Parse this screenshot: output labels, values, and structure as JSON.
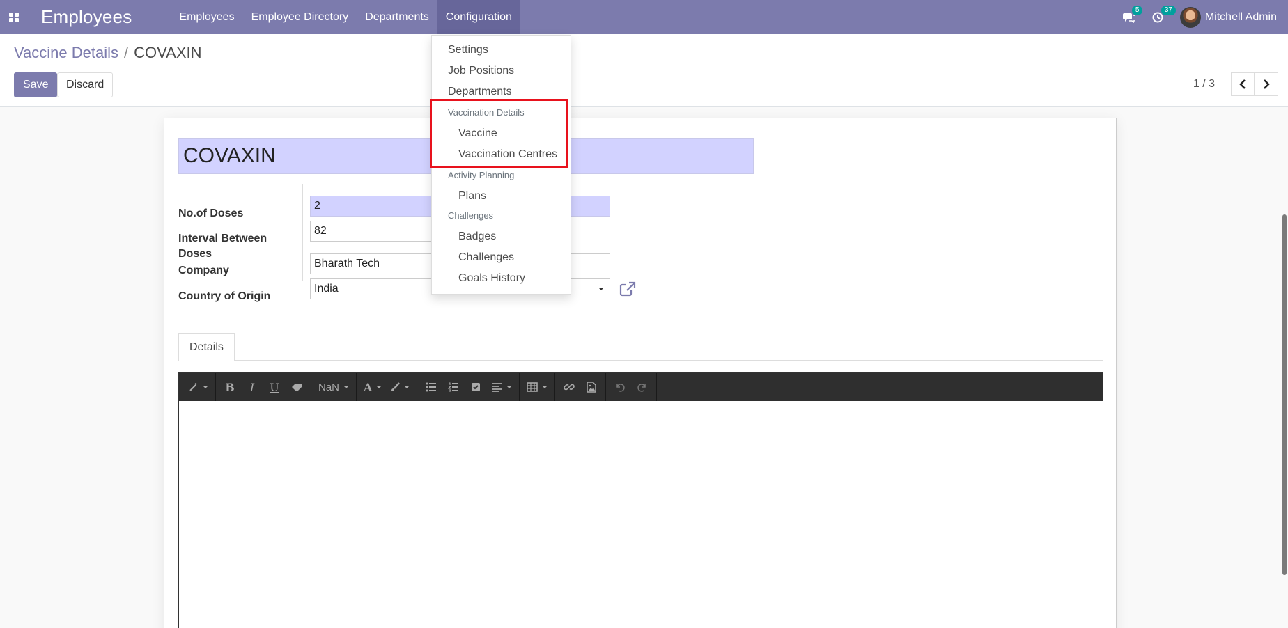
{
  "navbar": {
    "app_title": "Employees",
    "menu": [
      "Employees",
      "Employee Directory",
      "Departments",
      "Configuration"
    ],
    "messages_count": "5",
    "activities_count": "37",
    "user_name": "Mitchell Admin"
  },
  "breadcrumb": {
    "parent": "Vaccine Details",
    "separator": "/",
    "current": "COVAXIN"
  },
  "actions": {
    "save": "Save",
    "discard": "Discard"
  },
  "pager": {
    "text": "1 / 3"
  },
  "form": {
    "name": "COVAXIN",
    "fields": {
      "doses_label": "No.of Doses",
      "doses_value": "2",
      "interval_label_1": "Interval Between",
      "interval_label_2": "Doses",
      "interval_value": "82",
      "company_label": "Company",
      "company_value": "Bharath Tech",
      "country_label": "Country of Origin",
      "country_value": "India"
    },
    "tab": "Details",
    "font_size_value": "NaN"
  },
  "dropdown": {
    "settings": "Settings",
    "job_positions": "Job Positions",
    "departments": "Departments",
    "vaccination_header": "Vaccination Details",
    "vaccine": "Vaccine",
    "vaccination_centres": "Vaccination Centres",
    "activity_header": "Activity Planning",
    "plans": "Plans",
    "challenges_header": "Challenges",
    "badges": "Badges",
    "challenges": "Challenges",
    "goals_history": "Goals History"
  },
  "colors": {
    "brand": "#7c7bad",
    "required": "#d2d2ff",
    "highlight": "#e8121d"
  }
}
